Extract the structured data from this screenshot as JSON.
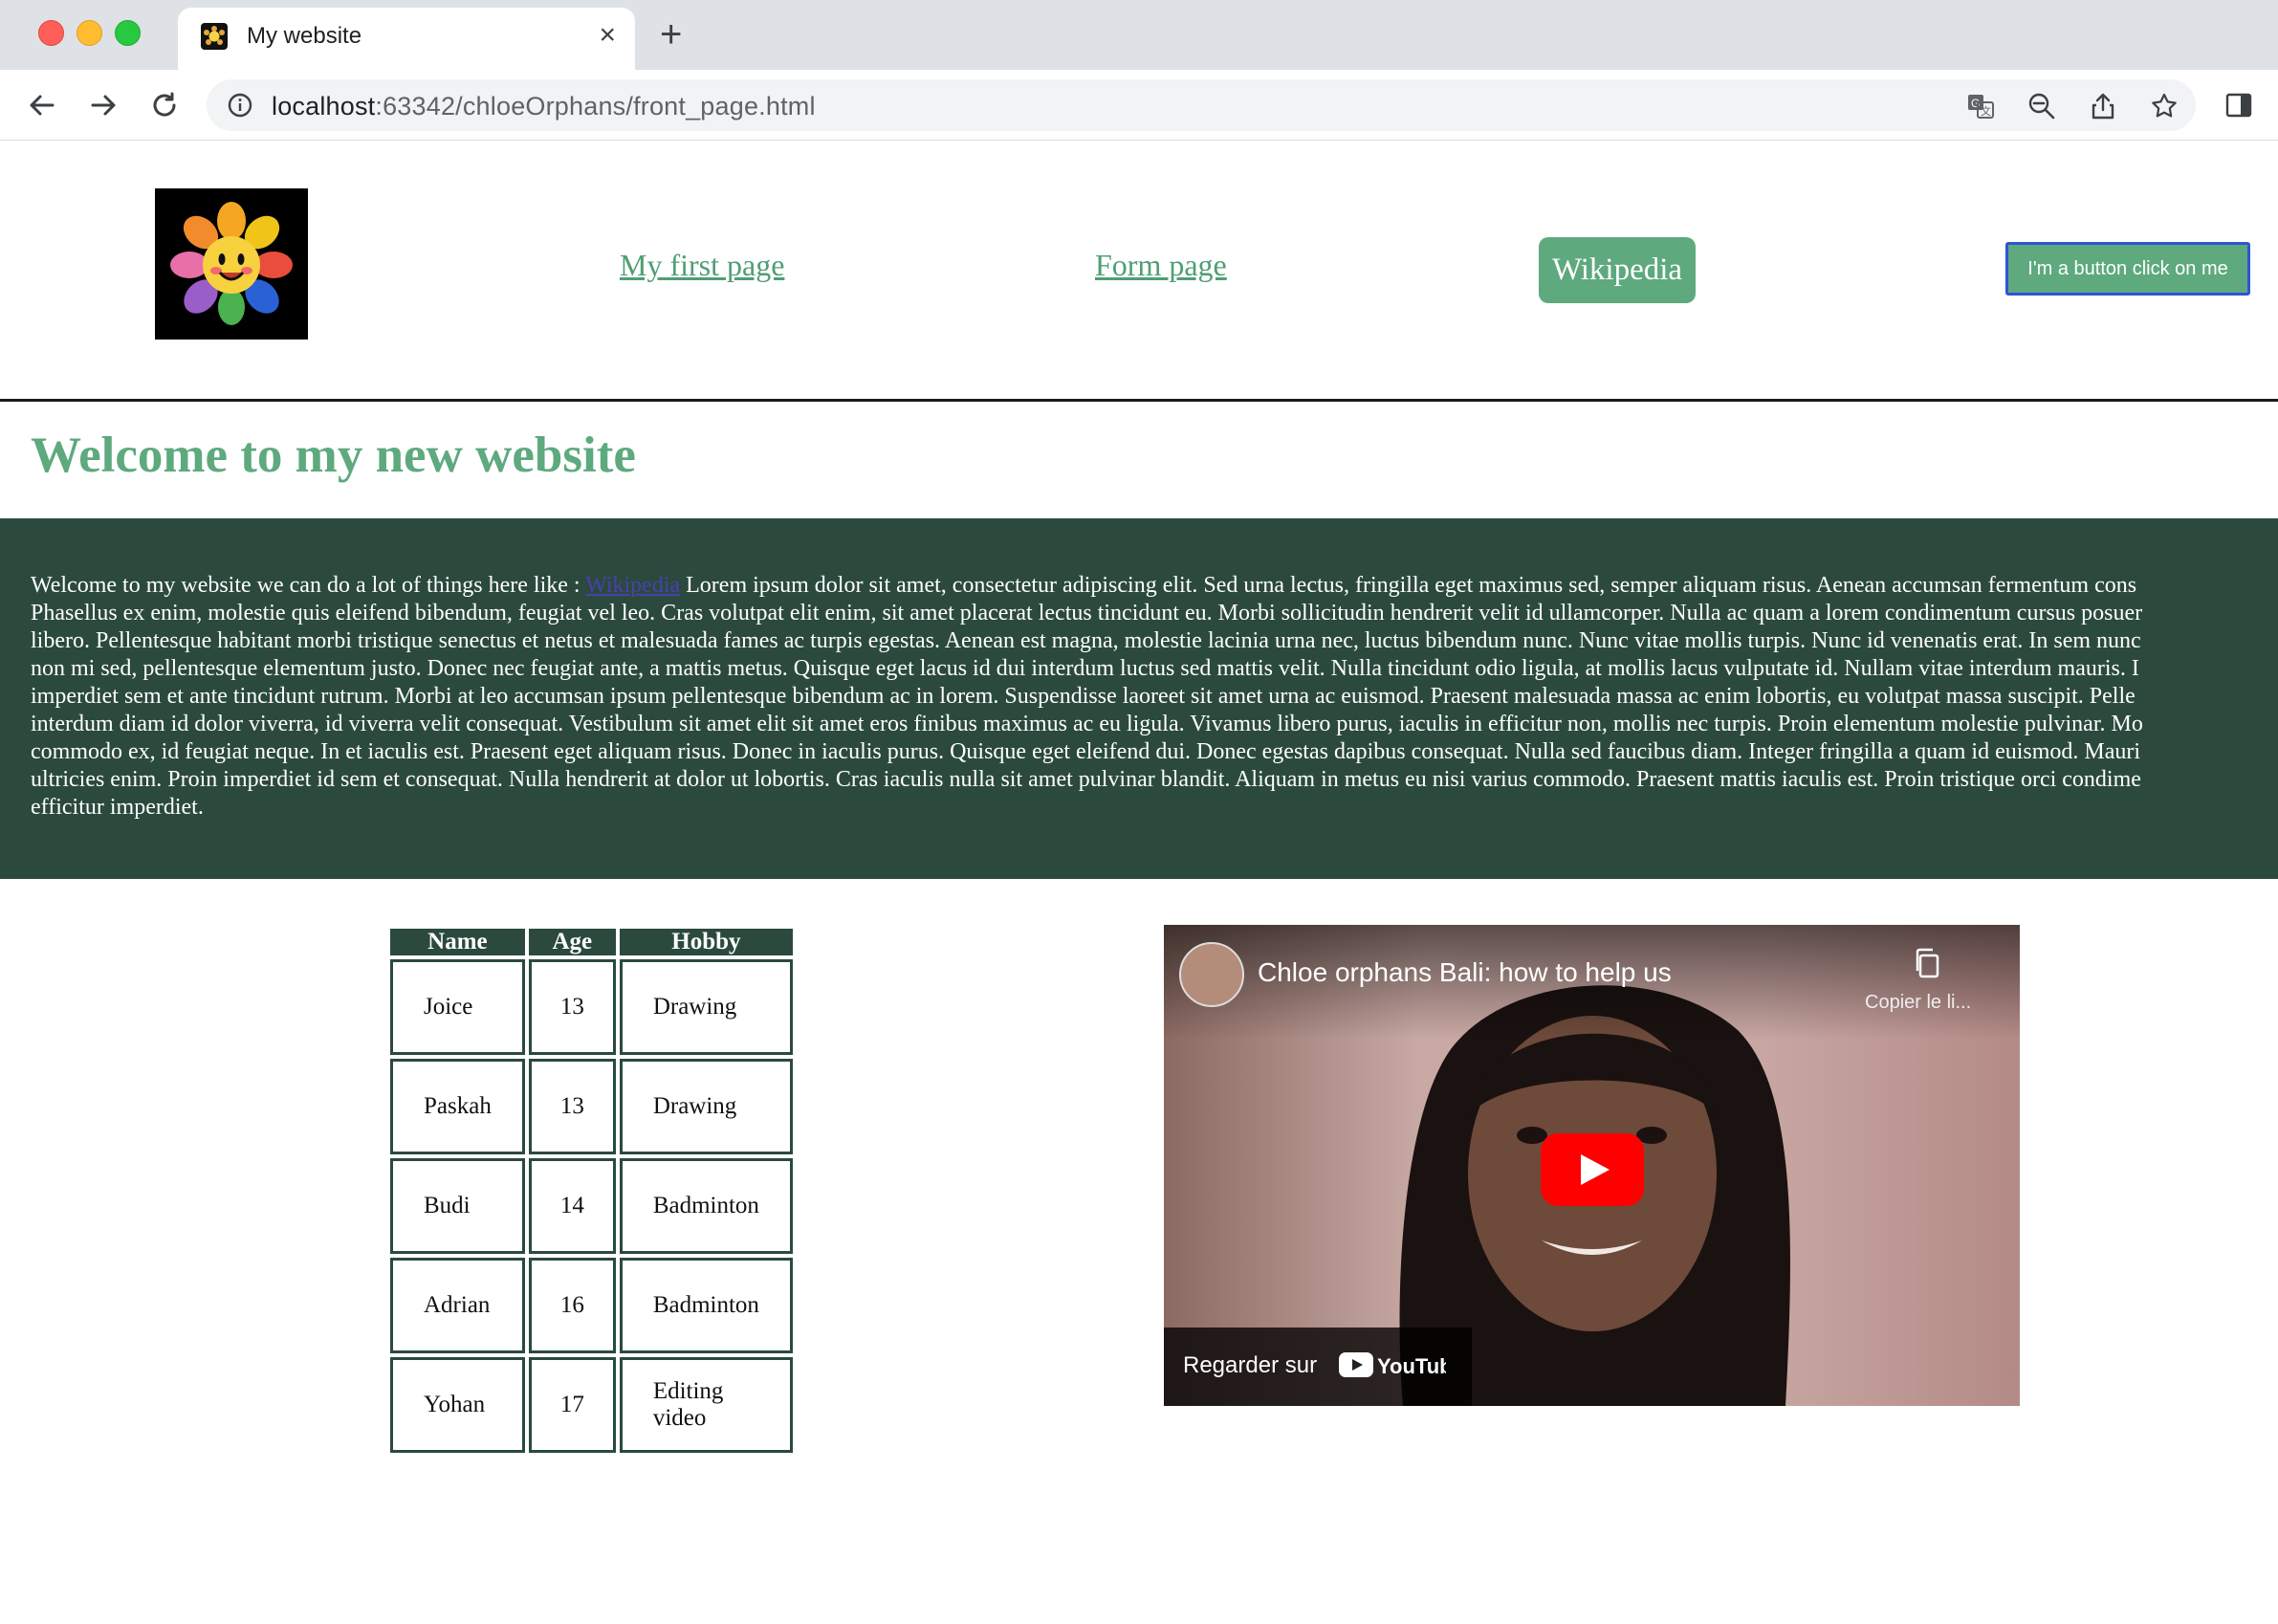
{
  "browser": {
    "tab_title": "My website",
    "tab_close": "×",
    "new_tab": "+",
    "url_host": "localhost",
    "url_rest": ":63342/chloeOrphans/front_page.html"
  },
  "nav": {
    "link1": "My first page",
    "link2": "Form page",
    "wiki": "Wikipedia",
    "button": "I'm a button click on me"
  },
  "heading": "Welcome to my new website",
  "banner": {
    "intro": "Welcome to my website we can do a lot of things here like : ",
    "link": "Wikipedia",
    "lines": [
      " Lorem ipsum dolor sit amet, consectetur adipiscing elit. Sed urna lectus, fringilla eget maximus sed, semper aliquam risus. Aenean accumsan fermentum cons",
      "Phasellus ex enim, molestie quis eleifend bibendum, feugiat vel leo. Cras volutpat elit enim, sit amet placerat lectus tincidunt eu. Morbi sollicitudin hendrerit velit id ullamcorper. Nulla ac quam a lorem condimentum cursus posuer",
      "libero. Pellentesque habitant morbi tristique senectus et netus et malesuada fames ac turpis egestas. Aenean est magna, molestie lacinia urna nec, luctus bibendum nunc. Nunc vitae mollis turpis. Nunc id venenatis erat. In sem nunc",
      "non mi sed, pellentesque elementum justo. Donec nec feugiat ante, a mattis metus. Quisque eget lacus id dui interdum luctus sed mattis velit. Nulla tincidunt odio ligula, at mollis lacus vulputate id. Nullam vitae interdum mauris. I",
      "imperdiet sem et ante tincidunt rutrum. Morbi at leo accumsan ipsum pellentesque bibendum ac in lorem. Suspendisse laoreet sit amet urna ac euismod. Praesent malesuada massa ac enim lobortis, eu volutpat massa suscipit. Pelle",
      "interdum diam id dolor viverra, id viverra velit consequat. Vestibulum sit amet elit sit amet eros finibus maximus ac eu ligula. Vivamus libero purus, iaculis in efficitur non, mollis nec turpis. Proin elementum molestie pulvinar. Mo",
      "commodo ex, id feugiat neque. In et iaculis est. Praesent eget aliquam risus. Donec in iaculis purus. Quisque eget eleifend dui. Donec egestas dapibus consequat. Nulla sed faucibus diam. Integer fringilla a quam id euismod. Mauri",
      "ultricies enim. Proin imperdiet id sem et consequat. Nulla hendrerit at dolor ut lobortis. Cras iaculis nulla sit amet pulvinar blandit. Aliquam in metus eu nisi varius commodo. Praesent mattis iaculis est. Proin tristique orci condime",
      "efficitur imperdiet."
    ]
  },
  "table": {
    "headers": [
      "Name",
      "Age",
      "Hobby"
    ],
    "rows": [
      [
        "Joice",
        "13",
        "Drawing"
      ],
      [
        "Paskah",
        "13",
        "Drawing"
      ],
      [
        "Budi",
        "14",
        "Badminton"
      ],
      [
        "Adrian",
        "16",
        "Badminton"
      ],
      [
        "Yohan",
        "17",
        "Editing video"
      ]
    ]
  },
  "video": {
    "title": "Chloe orphans Bali: how to help us",
    "copy_label": "Copier le li...",
    "watch_on": "Regarder sur",
    "brand": "YouTube"
  },
  "colors": {
    "accent": "#5ea97e",
    "dark_green": "#2b4a3d",
    "button_border": "#2f55d4"
  },
  "icons": [
    "back-icon",
    "forward-icon",
    "reload-icon",
    "info-icon",
    "translate-icon",
    "zoom-out-icon",
    "share-icon",
    "star-icon",
    "side-panel-icon",
    "copy-icon",
    "play-icon",
    "youtube-logo"
  ]
}
